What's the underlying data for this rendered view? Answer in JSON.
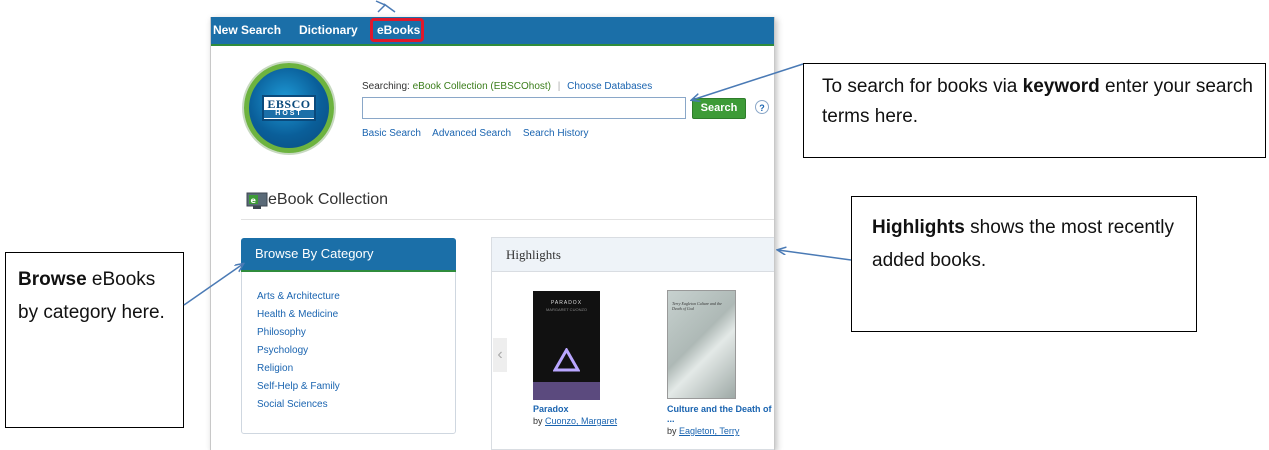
{
  "nav": {
    "new_search": "New Search",
    "dictionary": "Dictionary",
    "ebooks": "eBooks"
  },
  "logo": {
    "line1": "EBSCO",
    "line2": "HOST"
  },
  "search": {
    "searching_label": "Searching:",
    "database": "eBook Collection (EBSCOhost)",
    "choose_databases": "Choose Databases",
    "input_value": "",
    "button": "Search",
    "help": "?",
    "links": [
      "Basic Search",
      "Advanced Search",
      "Search History"
    ]
  },
  "collection": {
    "title": "eBook Collection"
  },
  "browse": {
    "title": "Browse By Category",
    "categories": [
      "Arts & Architecture",
      "Health & Medicine",
      "Philosophy",
      "Psychology",
      "Religion",
      "Self-Help & Family",
      "Social Sciences"
    ]
  },
  "highlights": {
    "title": "Highlights",
    "prev": "‹",
    "books": [
      {
        "title": "Paradox",
        "by": "by",
        "author": "Cuonzo, Margaret",
        "cover_title": "PARADOX",
        "cover_author": "MARGARET CUONZO"
      },
      {
        "title": "Culture and the Death of ...",
        "by": "by",
        "author": "Eagleton, Terry",
        "cover_title": "Terry Eagleton Culture and the Death of God"
      }
    ]
  },
  "callouts": {
    "search": {
      "pre": "To search for books via ",
      "bold": "keyword",
      "post": " enter your search terms here."
    },
    "highlights": {
      "bold": "Highlights",
      "post": " shows the most recently added books."
    },
    "browse": {
      "bold": "Browse",
      "post": " eBooks by category here."
    }
  },
  "colors": {
    "nav_blue": "#1b6fa8",
    "accent_green": "#3d9b37",
    "highlight_red": "#e0182b",
    "link_blue": "#1a64b0",
    "arrow": "#4a7ab5"
  }
}
